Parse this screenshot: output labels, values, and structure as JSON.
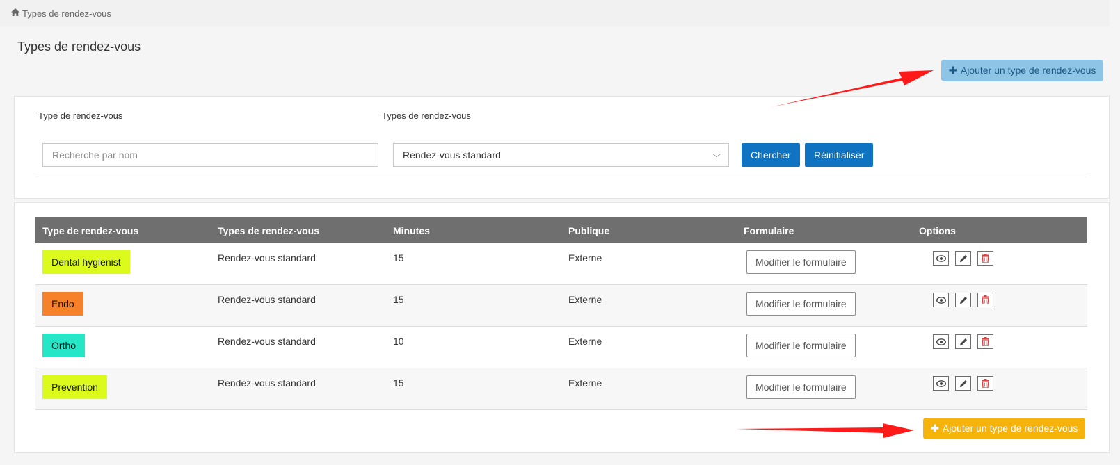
{
  "breadcrumb": {
    "home_icon": "home-icon",
    "label": "Types de rendez-vous"
  },
  "page": {
    "title": "Types de rendez-vous"
  },
  "actions": {
    "add_top_label": "Ajouter un type de rendez-vous",
    "add_bottom_label": "Ajouter un type de rendez-vous"
  },
  "filters": {
    "name_label": "Type de rendez-vous",
    "name_placeholder": "Recherche par nom",
    "name_value": "",
    "category_label": "Types de rendez-vous",
    "category_selected": "Rendez-vous standard",
    "search_button": "Chercher",
    "reset_button": "Réinitialiser"
  },
  "table": {
    "headers": [
      "Type de rendez-vous",
      "Types de rendez-vous",
      "Minutes",
      "Publique",
      "Formulaire",
      "Options"
    ],
    "rows": [
      {
        "name": "Dental hygienist",
        "color": "#dcfb1c",
        "category": "Rendez-vous standard",
        "minutes": "15",
        "visibility": "Externe",
        "form_button": "Modifier le formulaire"
      },
      {
        "name": "Endo",
        "color": "#f5822a",
        "category": "Rendez-vous standard",
        "minutes": "15",
        "visibility": "Externe",
        "form_button": "Modifier le formulaire"
      },
      {
        "name": "Ortho",
        "color": "#25e6c6",
        "category": "Rendez-vous standard",
        "minutes": "10",
        "visibility": "Externe",
        "form_button": "Modifier le formulaire"
      },
      {
        "name": "Prevention",
        "color": "#dcfb1c",
        "category": "Rendez-vous standard",
        "minutes": "15",
        "visibility": "Externe",
        "form_button": "Modifier le formulaire"
      }
    ],
    "option_icons": [
      "eye-icon",
      "pencil-icon",
      "trash-icon"
    ]
  },
  "colors": {
    "primary": "#0f73c1",
    "add_top": "#8ec4e6",
    "add_bottom": "#f5b30b",
    "annotation_arrow": "#ff1a1a",
    "table_header": "#6f6f6f"
  }
}
